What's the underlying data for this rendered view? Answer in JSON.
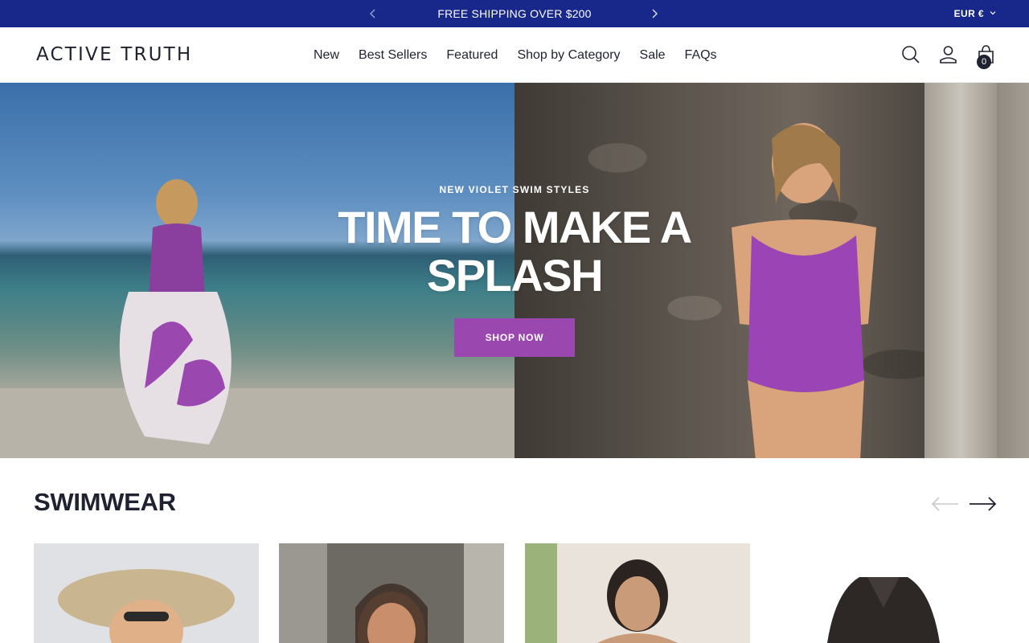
{
  "announcement": {
    "message": "FREE SHIPPING OVER $200",
    "currency": "EUR €"
  },
  "header": {
    "logo": "ACTIVE TRUTH",
    "nav": [
      "New",
      "Best Sellers",
      "Featured",
      "Shop by Category",
      "Sale",
      "FAQs"
    ],
    "cart_count": "0"
  },
  "hero": {
    "kicker": "NEW VIOLET SWIM STYLES",
    "title": "TIME TO MAKE A SPLASH",
    "button": "SHOP NOW",
    "accent_color": "#9a47b0"
  },
  "collection": {
    "title": "SWIMWEAR"
  },
  "colors": {
    "announcement_bg": "#17278a",
    "text": "#1f2230"
  },
  "icons": {
    "search": "search-icon",
    "account": "user-icon",
    "cart": "cart-icon",
    "prev": "chevron-left-icon",
    "next": "chevron-right-icon"
  }
}
